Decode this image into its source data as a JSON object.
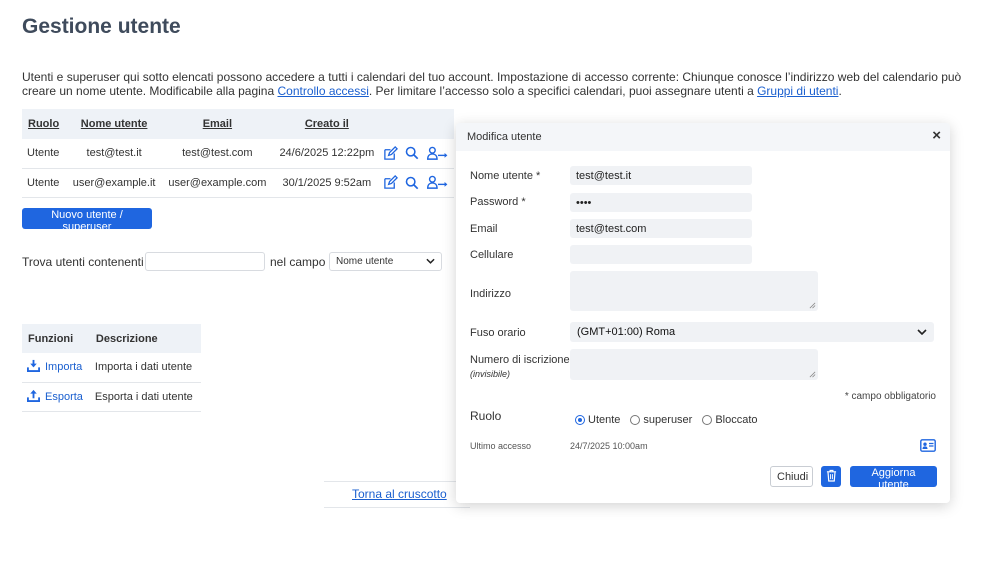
{
  "page": {
    "title": "Gestione utente",
    "intro_text_1": "Utenti e superuser qui sotto elencati possono accedere a tutti i calendari del tuo account. Impostazione di accesso corrente: Chiunque conosce l’indirizzo web del calendario può creare un nome utente. Modificabile alla pagina ",
    "intro_link_1": "Controllo accessi",
    "intro_text_2": ". Per limitare l’accesso solo a specifici calendari, puoi assegnare utenti a ",
    "intro_link_2": "Gruppi di utenti",
    "intro_text_3": "."
  },
  "users_table": {
    "headers": {
      "role": "Ruolo",
      "username": "Nome utente",
      "email": "Email",
      "created": "Creato il"
    },
    "rows": [
      {
        "role": "Utente",
        "username": "test@test.it",
        "email": "test@test.com",
        "created": "24/6/2025 12:22pm"
      },
      {
        "role": "Utente",
        "username": "user@example.it",
        "email": "user@example.com",
        "created": "30/1/2025 9:52am"
      }
    ]
  },
  "new_user_button": "Nuovo utente / superuser",
  "search": {
    "label": "Trova utenti contenenti",
    "value": "",
    "field_label": "nel campo",
    "field_selected": "Nome utente"
  },
  "functions_table": {
    "headers": {
      "function": "Funzioni",
      "description": "Descrizione"
    },
    "rows": [
      {
        "label": "Importa",
        "description": "Importa i dati utente",
        "icon": "import-icon"
      },
      {
        "label": "Esporta",
        "description": "Esporta i dati utente",
        "icon": "export-icon"
      }
    ]
  },
  "back_link": "Torna al cruscotto",
  "modal": {
    "title": "Modifica utente",
    "close": "×",
    "fields": {
      "username": {
        "label": "Nome utente *",
        "value": "test@test.it"
      },
      "password": {
        "label": "Password *",
        "value": "••••"
      },
      "email": {
        "label": "Email",
        "value": "test@test.com"
      },
      "mobile": {
        "label": "Cellulare",
        "value": ""
      },
      "address": {
        "label": "Indirizzo",
        "value": ""
      },
      "timezone": {
        "label": "Fuso orario",
        "value": "(GMT+01:00) Roma"
      },
      "registration": {
        "label": "Numero di iscrizione",
        "sublabel": "(invisibile)",
        "value": ""
      }
    },
    "required_note": "* campo obbligatorio",
    "role": {
      "label": "Ruolo",
      "options": [
        "Utente",
        "superuser",
        "Bloccato"
      ],
      "selected": "Utente"
    },
    "last_access": {
      "label": "Ultimo accesso",
      "value": "24/7/2025 10:00am"
    },
    "buttons": {
      "close": "Chiudi",
      "update": "Aggiorna utente"
    }
  },
  "colors": {
    "accent": "#1f66e0",
    "link": "#1a5fcf",
    "header_bg": "#eef2f7",
    "title": "#3f4b5c"
  }
}
